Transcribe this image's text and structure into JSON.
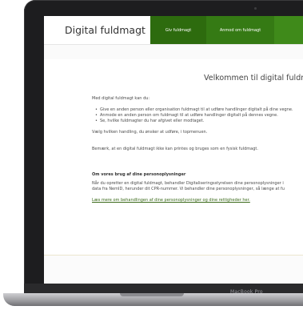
{
  "device": {
    "brand_label": "MacBook Pro"
  },
  "header": {
    "logo": "Digital fuldmagt",
    "nav": [
      {
        "label": "Giv fuldmagt"
      },
      {
        "label": "Anmod om fuldmagt"
      },
      {
        "label": ""
      }
    ],
    "colors": {
      "nav_dark": "#2d6b0e",
      "nav_mid": "#357a14",
      "nav_light": "#3f8a1a"
    }
  },
  "main": {
    "welcome": "Velkommen til digital fuldmagt",
    "intro": "Med digital fuldmagt kan du:",
    "bullets": [
      "Give en anden person eller organisation fuldmagt til at udføre handlinger digitalt på dine vegne.",
      "Anmode en anden person om fuldmagt til at udføre handlinger digitalt på dennes vegne.",
      "Se, hvilke fuldmagter du har afgivet eller modtaget."
    ],
    "choose_action": "Vælg hvilken handling, du ønsker at udføre, i topmenuen.",
    "note": "Bemærk, at en digital fuldmagt ikke kan printes og bruges som en fysisk fuldmagt.",
    "privacy_heading": "Om vores brug af dine personoplysninger",
    "privacy_line1": "Når du opretter en digital fuldmagt, behandler Digitaliseringsstyrelsen dine personoplysninger i",
    "privacy_line2": "data fra NemID, herunder dit CPR-nummer. Vi behandler dine personoplysninger, så længe at fu",
    "privacy_link": "Læs mere om behandlingen af dine personoplysninger og dine rettigheder her."
  }
}
